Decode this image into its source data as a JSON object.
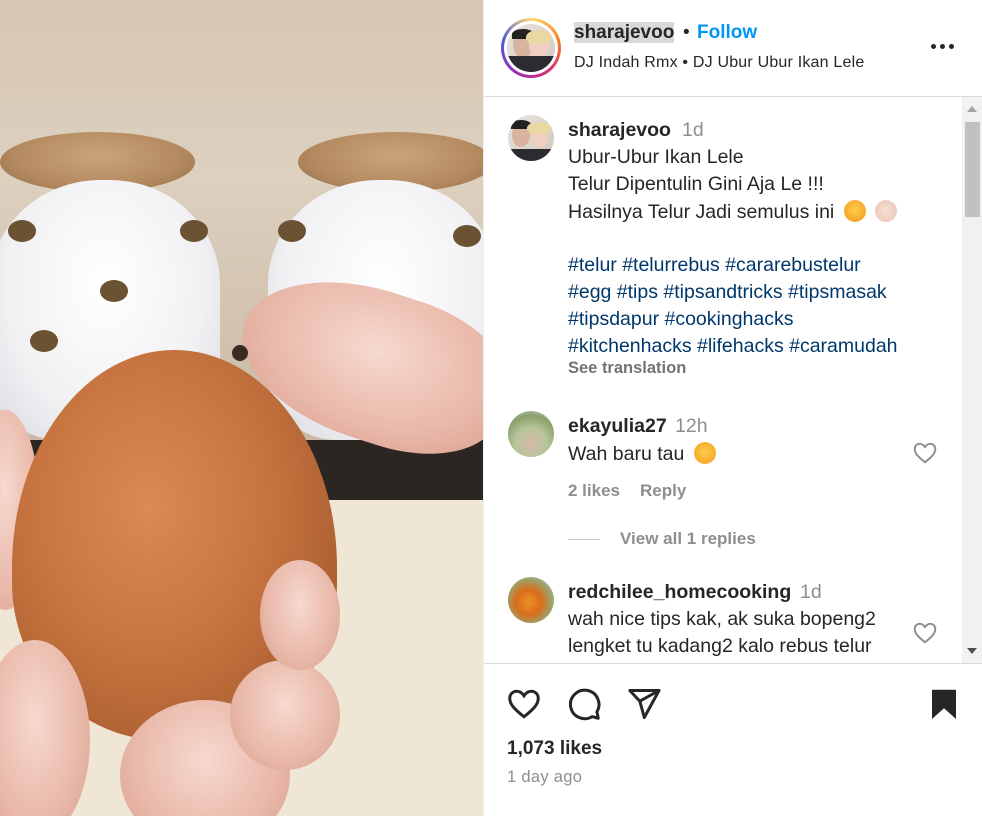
{
  "post": {
    "author": "sharajevoo",
    "follow_label": "Follow",
    "separator": "•",
    "audio": "DJ Indah Rmx • DJ Ubur Ubur Ikan Lele",
    "likes": "1,073 likes",
    "posted": "1 day ago"
  },
  "caption": {
    "user": "sharajevoo",
    "time": "1d",
    "line1": "Ubur-Ubur Ikan Lele",
    "line2": "Telur Dipentulin Gini Aja Le !!!",
    "line3": "Hasilnya Telur Jadi semulus ini",
    "hashtags_line1": "#telur #telurrebus #cararebustelur",
    "hashtags_line2": "#egg #tips #tipsandtricks #tipsmasak",
    "hashtags_line3": "#tipsdapur #cookinghacks",
    "hashtags_line4": "#kitchenhacks #lifehacks #caramudah",
    "see_translation": "See translation"
  },
  "comments": [
    {
      "user": "ekayulia27",
      "time": "12h",
      "text": "Wah baru tau",
      "likes": "2 likes",
      "reply_label": "Reply",
      "view_replies": "View all 1 replies"
    },
    {
      "user": "redchilee_homecooking",
      "time": "1d",
      "text_line1": "wah nice tips kak, ak suka bopeng2",
      "text_line2": "lengket tu kadang2 kalo rebus telur"
    }
  ],
  "icons": {
    "more": "more-horizontal-icon",
    "like": "heart-icon",
    "comment": "comment-icon",
    "share": "share-icon",
    "save": "bookmark-icon"
  },
  "colors": {
    "accent": "#0095f6",
    "hashtag": "#00376b",
    "muted": "#8e8e8e",
    "text": "#262626"
  }
}
